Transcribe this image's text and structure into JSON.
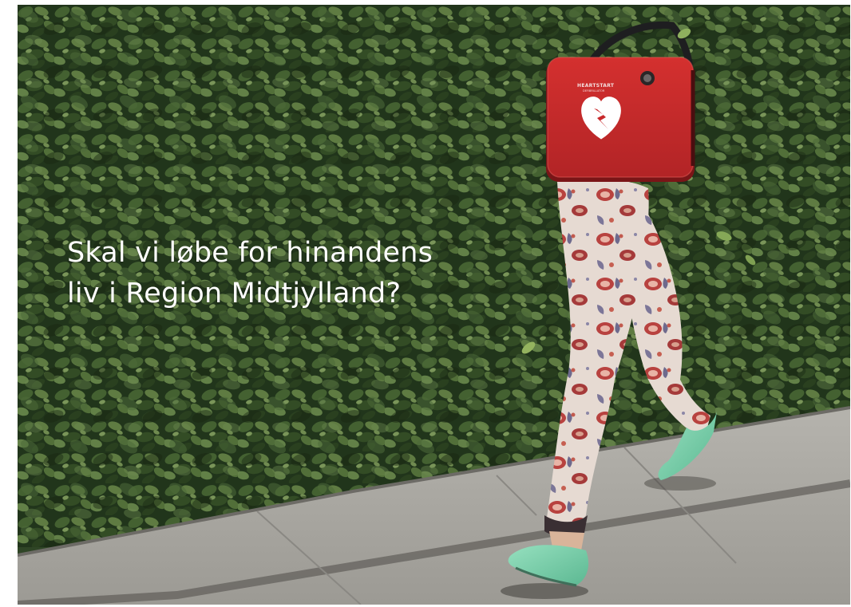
{
  "headline": {
    "line1": "Skal vi løbe for hinandens",
    "line2": "liv i Region Midtjylland?"
  },
  "device": {
    "brand": "HEARTSTART",
    "sub": "DEFIBRILLATOR"
  },
  "colors": {
    "hedge_dark": "#1f3219",
    "hedge_mid": "#3d5a2c",
    "hedge_light": "#6f8e4e",
    "sidewalk": "#a7a59f",
    "bag_red": "#c8282b",
    "shoe_green": "#7fd3ae",
    "pants_base": "#e9ddd6",
    "pattern_red": "#b8423f"
  },
  "icons": {
    "device_logo": "heart-with-lightning-icon"
  }
}
